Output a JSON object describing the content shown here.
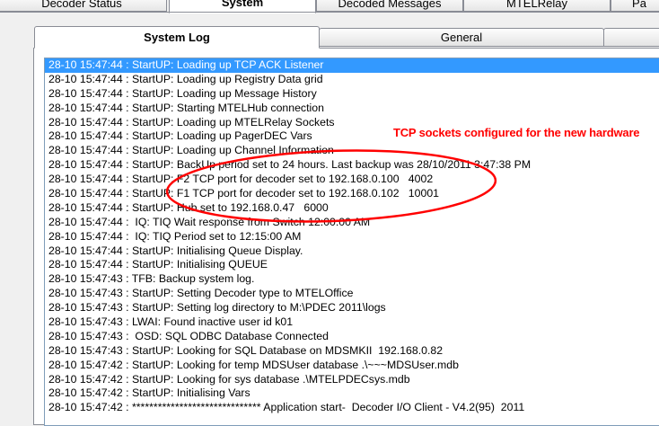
{
  "top_tabs": [
    {
      "label": "Decoder Status",
      "active": false
    },
    {
      "label": "System",
      "active": true
    },
    {
      "label": "Decoded Messages",
      "active": false
    },
    {
      "label": "MTELRelay",
      "active": false
    },
    {
      "label": "Pa",
      "active": false
    }
  ],
  "sub_tabs": [
    {
      "label": "System Log",
      "active": true
    },
    {
      "label": "General",
      "active": false
    },
    {
      "label": "",
      "active": false
    }
  ],
  "log": [
    "28-10 15:47:44 : StartUP: Loading up TCP ACK Listener",
    "28-10 15:47:44 : StartUP: Loading up Registry Data grid",
    "28-10 15:47:44 : StartUP: Loading up Message History",
    "28-10 15:47:44 : StartUP: Starting MTELHub connection",
    "28-10 15:47:44 : StartUP: Loading up MTELRelay Sockets",
    "28-10 15:47:44 : StartUP: Loading up PagerDEC Vars",
    "28-10 15:47:44 : StartUP: Loading up Channel Information",
    "28-10 15:47:44 : StartUP: BackUp period set to 24 hours. Last backup was 28/10/2011 3:47:38 PM",
    "28-10 15:47:44 : StartUP: F2 TCP port for decoder set to 192.168.0.100   4002",
    "28-10 15:47:44 : StartUP: F1 TCP port for decoder set to 192.168.0.102   10001",
    "28-10 15:47:44 : StartUP: Hub set to 192.168.0.47   6000",
    "28-10 15:47:44 :  IQ: TIQ Wait response from Switch 12:00:00 AM",
    "28-10 15:47:44 :  IQ: TIQ Period set to 12:15:00 AM",
    "28-10 15:47:44 : StartUP: Initialising Queue Display.",
    "28-10 15:47:44 : StartUP: Initialising QUEUE",
    "28-10 15:47:43 : TFB: Backup system log.",
    "28-10 15:47:43 : StartUP: Setting Decoder type to MTELOffice",
    "28-10 15:47:43 : StartUP: Setting log directory to M:\\PDEC 2011\\logs",
    "28-10 15:47:43 : LWAI: Found inactive user id k01",
    "28-10 15:47:43 :  OSD: SQL ODBC Database Connected",
    "28-10 15:47:43 : StartUP: Looking for SQL Database on MDSMKII  192.168.0.82",
    "28-10 15:47:42 : StartUP: Looking for temp MDSUser database .\\~~~MDSUser.mdb",
    "28-10 15:47:42 : StartUP: Looking for sys database .\\MTELPDECsys.mdb",
    "28-10 15:47:42 : StartUP: Initialising Vars",
    "28-10 15:47:42 : ****************************** Application start-  Decoder I/O Client - V4.2(95)  2011"
  ],
  "selected_row": 0,
  "annotation": "TCP sockets configured for the new hardware",
  "colors": {
    "selection": "#3399ff",
    "annotation": "#ff0000",
    "tab_border": "#898c95"
  }
}
